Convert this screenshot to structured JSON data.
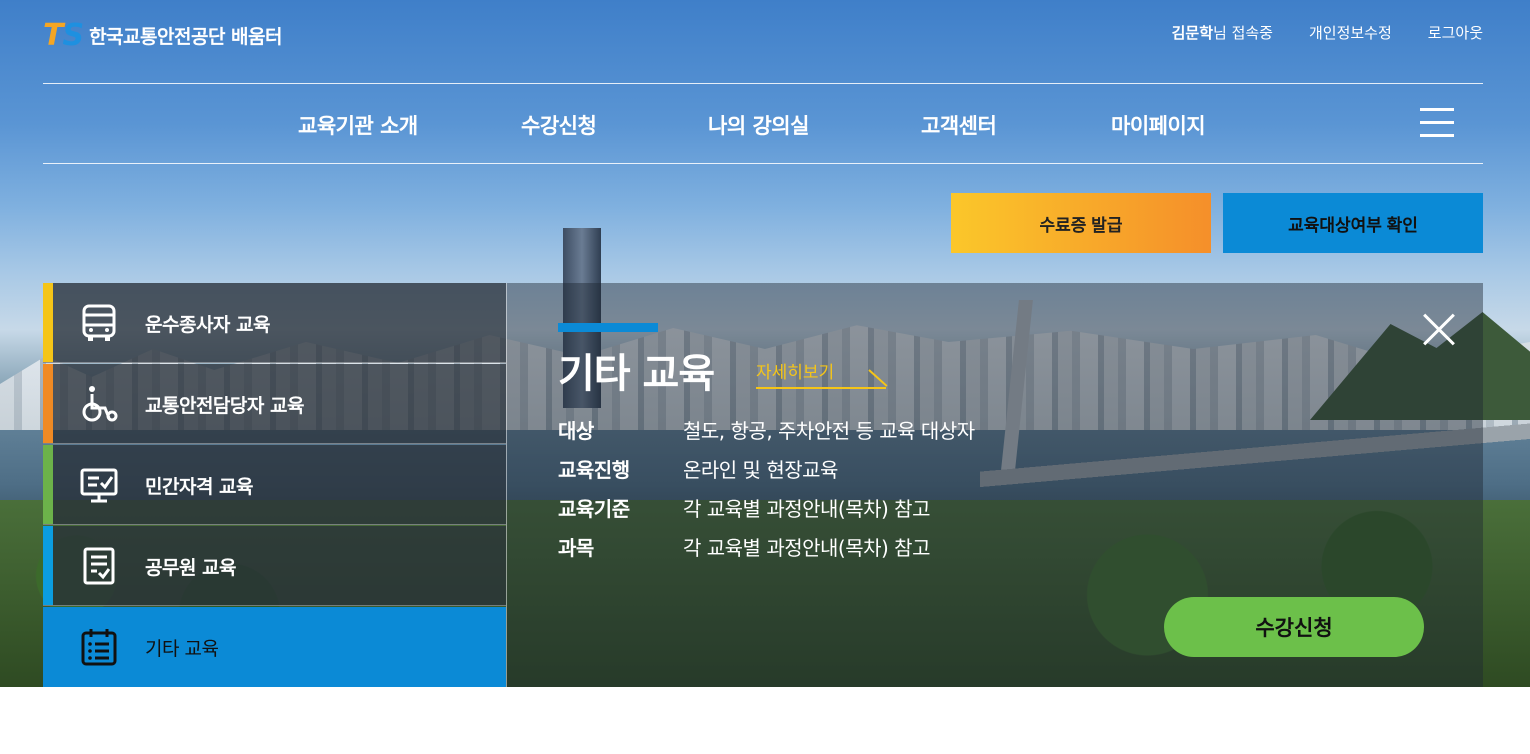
{
  "header": {
    "logo_mark_t": "T",
    "logo_mark_s": "S",
    "logo_text": "한국교통안전공단 배움터",
    "user_name": "김문학",
    "user_suffix": "님 접속중",
    "edit_profile": "개인정보수정",
    "logout": "로그아웃"
  },
  "nav": {
    "items": [
      "교육기관 소개",
      "수강신청",
      "나의 강의실",
      "고객센터",
      "마이페이지"
    ]
  },
  "actions": {
    "certificate": "수료증 발급",
    "eligibility_check": "교육대상여부 확인"
  },
  "tabs": [
    {
      "label": "운수종사자 교육",
      "icon": "bus-icon",
      "color": "#f5c518"
    },
    {
      "label": "교통안전담당자 교육",
      "icon": "wheelchair-icon",
      "color": "#f08a24"
    },
    {
      "label": "민간자격 교육",
      "icon": "monitor-check-icon",
      "color": "#6cb24a"
    },
    {
      "label": "공무원 교육",
      "icon": "document-check-icon",
      "color": "#0b9de0"
    },
    {
      "label": "기타 교육",
      "icon": "calendar-list-icon",
      "color": "#0b8ad6",
      "active": true
    }
  ],
  "detail": {
    "title": "기타 교육",
    "more_link": "자세히보기",
    "rows": [
      {
        "key": "대상",
        "value": "철도, 항공, 주차안전 등 교육 대상자"
      },
      {
        "key": "교육진행",
        "value": "온라인 및 현장교육"
      },
      {
        "key": "교육기준",
        "value": "각 교육별 과정안내(목차) 참고"
      },
      {
        "key": "과목",
        "value": "각 교육별 과정안내(목차) 참고"
      }
    ],
    "enroll_button": "수강신청"
  },
  "colors": {
    "primary_blue": "#0b8ad6",
    "accent_yellow": "#f5c518",
    "enroll_green": "#6cc04a",
    "cert_gradient_start": "#fbc72a",
    "cert_gradient_end": "#f58f2a"
  }
}
